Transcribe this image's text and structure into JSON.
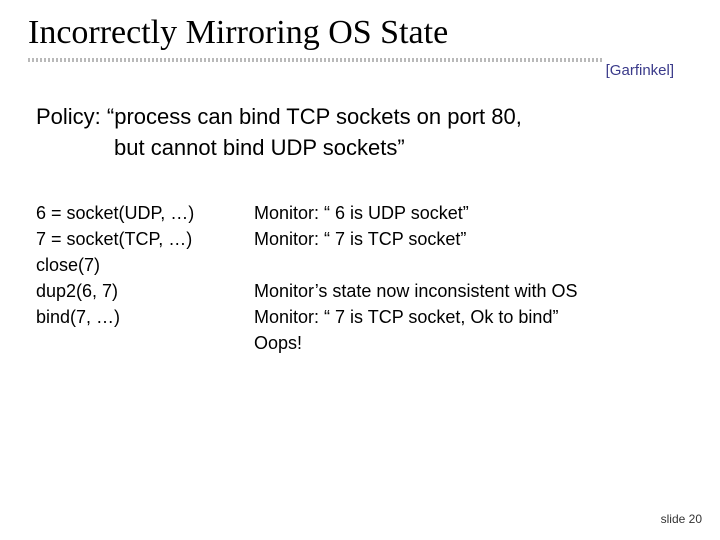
{
  "title": "Incorrectly Mirroring OS State",
  "citation": "[Garfinkel]",
  "policy": {
    "line1": "Policy: “process can bind TCP sockets on port 80,",
    "line2": "but cannot bind UDP sockets”"
  },
  "left": {
    "l1": "6 = socket(UDP, …)",
    "l2": "7 = socket(TCP, …)",
    "l3": "close(7)",
    "l4": "dup2(6, 7)",
    "l5": "bind(7, …)"
  },
  "right": {
    "r1": "Monitor: “ 6 is UDP socket”",
    "r2": "Monitor: “ 7 is TCP socket”",
    "r3": "Monitor’s state now inconsistent with OS",
    "r4": "Monitor: “ 7 is TCP socket, Ok to bind”",
    "r5": "Oops!"
  },
  "footer": "slide 20"
}
